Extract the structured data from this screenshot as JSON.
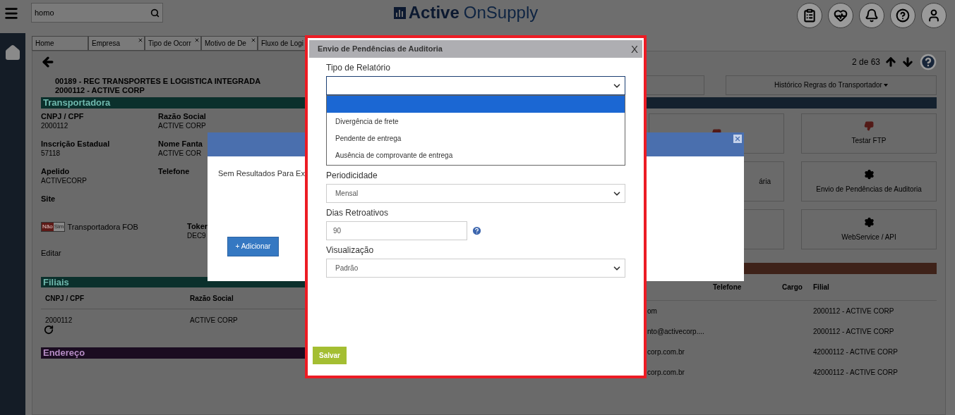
{
  "header": {
    "search": {
      "value": "homo"
    },
    "logo": {
      "primary": "Active",
      "secondary": "OnSupply"
    }
  },
  "tabs": [
    {
      "label": "Home",
      "closable": false
    },
    {
      "label": "Empresa",
      "closable": true
    },
    {
      "label": "Tipo de Ocorr",
      "closable": true
    },
    {
      "label": "Motivo de De",
      "closable": true
    },
    {
      "label": "Fluxo de Logi"
    }
  ],
  "pager": {
    "text": "2 de 63"
  },
  "company": {
    "lines": [
      "00189 - REC TRANSPORTES E LOGISTICA INTEGRADA",
      "2000112 - ACTIVE CORP"
    ]
  },
  "transportadora": {
    "title": "Transportadora",
    "fields": [
      {
        "label": "CNPJ / CPF",
        "value": "2000112"
      },
      {
        "label": "Razão Social",
        "value": "ACTIVE CORP"
      },
      {
        "label": "Inscrição Estadual",
        "value": "57118"
      },
      {
        "label": "Nome Fanta",
        "value": "ACTIVE COR"
      },
      {
        "label": "Apelido",
        "value": "ACTIVECORP"
      },
      {
        "label": "Telefone"
      },
      {
        "label": "Site"
      }
    ],
    "fob_toggle": {
      "off_label": "Não",
      "on_label": "Sim",
      "on": false,
      "label": "Transportadora FOB"
    },
    "token": {
      "label": "Toker",
      "value": "DEC9"
    },
    "edit": "Editar"
  },
  "filiais": {
    "title": "Filiais",
    "columns": [
      "CNPJ / CPF",
      "Razão Social"
    ],
    "rows": [
      [
        "2000112",
        "ACTIVE CORP"
      ]
    ]
  },
  "endereco": {
    "title": "Endereço"
  },
  "right_panel": {
    "history_button": "Histórico Regras do Transportador",
    "cards": [
      {
        "kind": "alert"
      },
      {
        "label": "Testar FTP",
        "kind": "alert"
      },
      {
        "label": "ária",
        "kind": "plain"
      },
      {
        "label": "Envio de Pendências de Auditoria",
        "kind": "setting"
      },
      {
        "kind": "plain"
      },
      {
        "label": "WebService / API",
        "kind": "setting"
      }
    ]
  },
  "contacts": {
    "columns": [
      "Telefone",
      "Cargo",
      "Filial"
    ],
    "rows": [
      {
        "column_1": "om",
        "filial": "2000112 - ACTIVE CORP"
      },
      {
        "column_1": "nto@activecorp....",
        "filial": "2000112 - ACTIVE CORP"
      },
      {
        "column_1": "corp.com.br",
        "filial": "42000112 - ACTIVE CORP"
      },
      {
        "column_1": "corp.com.br",
        "filial": "42000112 - ACTIVE CORP"
      }
    ]
  },
  "background_dialog": {
    "message": "Sem Resultados Para Ex",
    "add_button": "+ Adicionar"
  },
  "dialog": {
    "title": "Envio de Pendências de Auditoria",
    "close": "X",
    "fields": [
      {
        "kind": "select",
        "label": "Tipo de Relatório",
        "open": true,
        "options": [
          {
            "selected": true
          },
          {
            "label": "Divergência de frete",
            "selected": false
          },
          {
            "label": "Pendente de entrega",
            "selected": false
          },
          {
            "label": "Ausência de comprovante de entrega",
            "selected": false
          }
        ]
      },
      {
        "kind": "select",
        "label": "Periodicidade",
        "value": "Mensal",
        "open": false
      },
      {
        "kind": "number",
        "label": "Dias Retroativos",
        "value": "90",
        "help": true
      },
      {
        "kind": "select",
        "label": "Visualização",
        "value": "Padrão",
        "open": false
      }
    ],
    "save": "Salvar"
  }
}
